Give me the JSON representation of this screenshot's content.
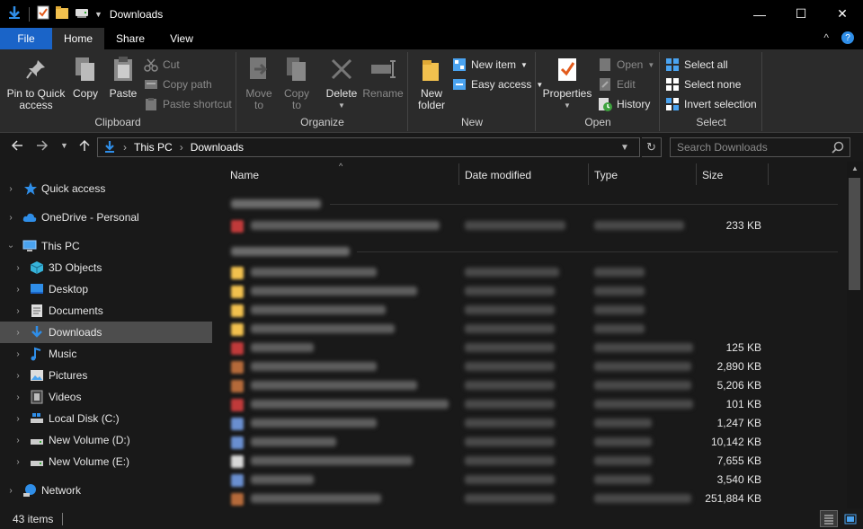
{
  "window": {
    "title": "Downloads",
    "minimize": "—",
    "maximize": "☐",
    "close": "✕"
  },
  "ribbon_tabs": {
    "file": "File",
    "home": "Home",
    "share": "Share",
    "view": "View",
    "collapse": "^",
    "help": "?"
  },
  "clipboard": {
    "pin_line1": "Pin to Quick",
    "pin_line2": "access",
    "copy": "Copy",
    "paste": "Paste",
    "cut": "Cut",
    "copy_path": "Copy path",
    "paste_shortcut": "Paste shortcut",
    "label": "Clipboard"
  },
  "organize": {
    "move_line1": "Move",
    "move_line2": "to",
    "copy_line1": "Copy",
    "copy_line2": "to",
    "delete": "Delete",
    "rename": "Rename",
    "label": "Organize"
  },
  "new_group": {
    "new_folder_line1": "New",
    "new_folder_line2": "folder",
    "new_item": "New item",
    "easy_access": "Easy access",
    "label": "New"
  },
  "open_group": {
    "properties": "Properties",
    "open": "Open",
    "edit": "Edit",
    "history": "History",
    "label": "Open"
  },
  "select_group": {
    "select_all": "Select all",
    "select_none": "Select none",
    "invert": "Invert selection",
    "label": "Select"
  },
  "address": {
    "this_pc": "This PC",
    "downloads": "Downloads",
    "sep": "›"
  },
  "search": {
    "placeholder": "Search Downloads"
  },
  "nav": {
    "quick_access": "Quick access",
    "onedrive": "OneDrive - Personal",
    "this_pc": "This PC",
    "objects3d": "3D Objects",
    "desktop": "Desktop",
    "documents": "Documents",
    "downloads": "Downloads",
    "music": "Music",
    "pictures": "Pictures",
    "videos": "Videos",
    "local_c": "Local Disk (C:)",
    "vol_d": "New Volume (D:)",
    "vol_e": "New Volume (E:)",
    "network": "Network"
  },
  "columns": {
    "name": "Name",
    "date": "Date modified",
    "type": "Type",
    "size": "Size"
  },
  "file_sizes": [
    "233 KB",
    "125 KB",
    "2,890 KB",
    "5,206 KB",
    "101 KB",
    "1,247 KB",
    "10,142 KB",
    "7,655 KB",
    "3,540 KB",
    "251,884 KB"
  ],
  "status": {
    "count": "43 items"
  },
  "colors": {
    "accent": "#1a64c8",
    "folder": "#f2c14e",
    "background": "#191919"
  }
}
